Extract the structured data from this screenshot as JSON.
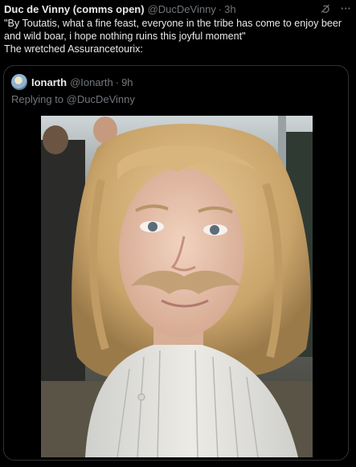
{
  "tweet": {
    "author_name": "Duc de Vinny (comms open)",
    "author_handle": "@DucDeVinny",
    "separator": "·",
    "time": "3h",
    "more_label": "···",
    "text": "\"By Toutatis, what a fine feast, everyone in the tribe has come to enjoy beer and wild boar, i hope nothing ruins this joyful moment\"\nThe wretched Assurancetourix:"
  },
  "quote": {
    "author_name": "Ionarth",
    "author_handle": "@Ionarth",
    "separator": "·",
    "time": "9h",
    "replying_prefix": "Replying to ",
    "replying_to": "@DucDeVinny"
  },
  "media": {
    "description_icon": "photo",
    "subject": "child-with-fake-mustache-photo"
  },
  "icons": {
    "grok": "grok-icon",
    "more": "more-icon",
    "avatar": "avatar"
  },
  "colors": {
    "background": "#000000",
    "text": "#e7e9ea",
    "muted": "#71767b",
    "border": "#2f3336"
  }
}
